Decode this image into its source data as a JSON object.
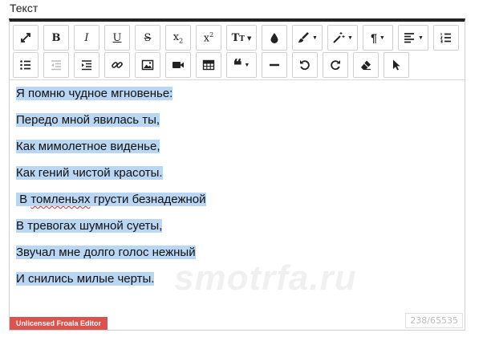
{
  "field_label": "Текст",
  "toolbar": {
    "fullscreen": "fullscreen",
    "bold": "B",
    "italic": "I",
    "underline": "U",
    "strike": "S",
    "subscript_base": "x",
    "subscript_mark": "2",
    "superscript_base": "x",
    "superscript_mark": "2",
    "font_size": "T",
    "font_size_mark": "T"
  },
  "content": {
    "lines": [
      "Я помню чудное мгновенье:",
      "Передо мной явилась ты,",
      "Как мимолетное виденье,",
      "Как гений чистой красоты.",
      " В ",
      "томленьях",
      " грусти безнадежной",
      "В тревогах шумной суеты,",
      "Звучал мне долго голос нежный",
      "И снились милые черты."
    ]
  },
  "watermark": "smotrfa.ru",
  "license_label": "Unlicensed Froala Editor",
  "counter": "238/65535",
  "colors": {
    "selection": "#b9d6f2",
    "license_bg": "#d9534f",
    "toolbar_top": "#222222"
  }
}
